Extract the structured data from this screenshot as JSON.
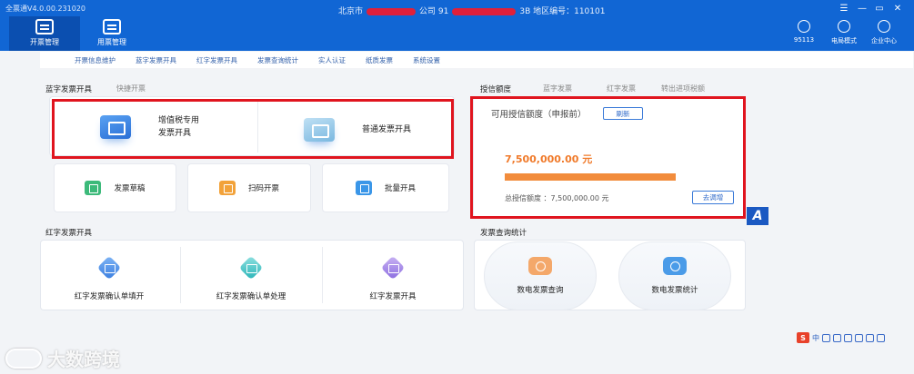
{
  "app": {
    "version": "全票通V4.0.00.231020",
    "company_prefix": "北京市",
    "company_mid": "公司 91",
    "company_suffix": "3B  地区编号：110101"
  },
  "window_controls": [
    "☰",
    "—",
    "▭",
    "✕"
  ],
  "nav_tabs": [
    {
      "label": "开票管理",
      "active": true
    },
    {
      "label": "用票管理",
      "active": false
    }
  ],
  "right_tools": [
    {
      "label": "95113",
      "icon": "phone-icon"
    },
    {
      "label": "电局模式",
      "icon": "message-icon"
    },
    {
      "label": "企业中心",
      "icon": "user-icon"
    }
  ],
  "submenu": [
    "开票信息维护",
    "蓝字发票开具",
    "红字发票开具",
    "发票查询统计",
    "实人认证",
    "纸质发票",
    "系统设置"
  ],
  "blue_section": {
    "title": "蓝字发票开具",
    "tab2": "快捷开票",
    "btn_vat_line1": "增值税专用",
    "btn_vat_line2": "发票开具",
    "btn_normal": "普通发票开具",
    "draft": "发票草稿",
    "scan": "扫码开票",
    "batch": "批量开具"
  },
  "credit_section": {
    "tabs": [
      "授信额度",
      "蓝字发票",
      "红字发票",
      "转出进项税额"
    ],
    "title": "可用授信额度（申报前）",
    "refresh": "刷新",
    "amount": "7,500,000.00 元",
    "usage_fraction": 1.0,
    "total": "总授信额度 ：7,500,000.00 元",
    "apply": "去调增"
  },
  "red_section": {
    "title": "红字发票开具",
    "items": [
      "红字发票确认单填开",
      "红字发票确认单处理",
      "红字发票开具"
    ]
  },
  "query_section": {
    "title": "发票查询统计",
    "items": [
      "数电发票查询",
      "数电发票统计"
    ]
  },
  "ime": {
    "logo": "S",
    "lang": "中"
  },
  "watermark": "大数跨境",
  "side_badge": "A",
  "colors": {
    "brand_blue": "#1166d4",
    "highlight_red": "#e0141e",
    "amount_orange": "#f07a2a"
  }
}
